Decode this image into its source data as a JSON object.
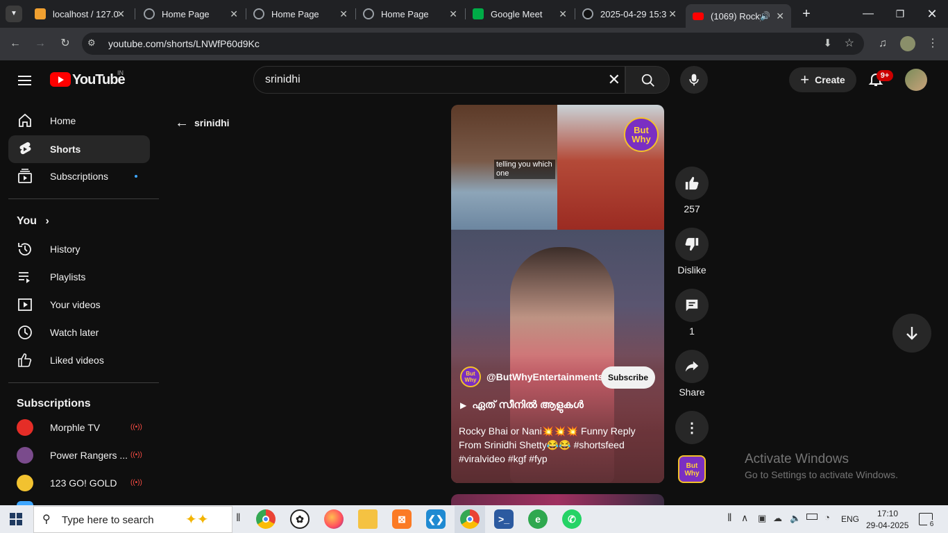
{
  "browser": {
    "tabs": [
      {
        "title": "localhost / 127.0",
        "active": false
      },
      {
        "title": "Home Page",
        "active": false
      },
      {
        "title": "Home Page",
        "active": false
      },
      {
        "title": "Home Page",
        "active": false
      },
      {
        "title": "Google Meet",
        "active": false
      },
      {
        "title": "2025-04-29 15:3",
        "active": false
      },
      {
        "title": "(1069) Rocky",
        "active": true
      }
    ],
    "url": "youtube.com/shorts/LNWfP60d9Kc"
  },
  "youtube": {
    "logo_text": "YouTube",
    "country_code": "IN",
    "search_value": "srinidhi",
    "create_label": "Create",
    "notification_count": "9+",
    "back_query": "srinidhi"
  },
  "sidebar": {
    "main": [
      {
        "label": "Home",
        "icon": "home-icon"
      },
      {
        "label": "Shorts",
        "icon": "shorts-icon",
        "selected": true
      },
      {
        "label": "Subscriptions",
        "icon": "subscriptions-icon"
      }
    ],
    "you_heading": "You",
    "you_items": [
      {
        "label": "History",
        "icon": "history-icon"
      },
      {
        "label": "Playlists",
        "icon": "playlists-icon"
      },
      {
        "label": "Your videos",
        "icon": "your-videos-icon"
      },
      {
        "label": "Watch later",
        "icon": "watch-later-icon"
      },
      {
        "label": "Liked videos",
        "icon": "liked-videos-icon"
      }
    ],
    "subs_heading": "Subscriptions",
    "subs": [
      {
        "label": "Morphle TV",
        "color": "#e52d27"
      },
      {
        "label": "Power Rangers ...",
        "color": "#7a4b8c"
      },
      {
        "label": "123 GO! GOLD",
        "color": "#f2c230"
      }
    ]
  },
  "short": {
    "caption_overlay": "telling you which one",
    "channel_handle": "@ButWhyEntertainments",
    "channel_logo_text": "But Why",
    "subscribe_label": "Subscribe",
    "sound_title": "ഏത് സീനിൽ ആളുകൾ",
    "title": "Rocky Bhai or Nani💥💥💥 Funny Reply From  Srinidhi Shetty😂😂 #shortsfeed #viralvideo #kgf #fyp",
    "likes": "257",
    "dislike_label": "Dislike",
    "comments": "1",
    "share_label": "Share"
  },
  "watermark": {
    "title": "Activate Windows",
    "subtitle": "Go to Settings to activate Windows."
  },
  "taskbar": {
    "search_placeholder": "Type here to search",
    "language": "ENG",
    "time": "17:10",
    "date": "29-04-2025",
    "notifications": "6"
  },
  "colors": {
    "yt_red": "#ff0000",
    "accent_blue": "#3ea6ff",
    "bg": "#0f0f0f"
  }
}
